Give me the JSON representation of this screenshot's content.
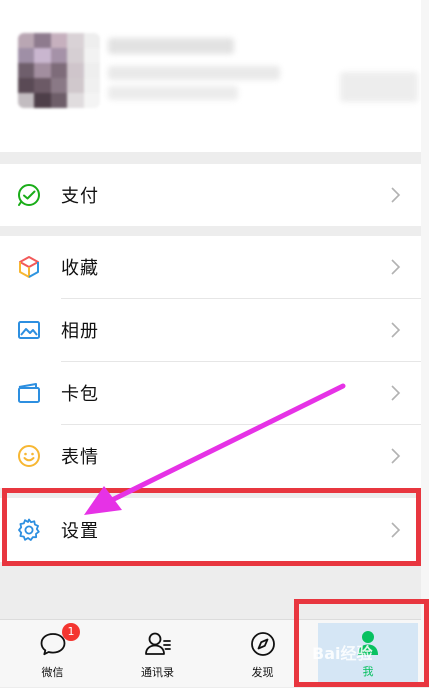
{
  "colors": {
    "accent_green": "#07c160",
    "annotation_red": "#e8363f",
    "arrow_magenta": "#e632e6",
    "badge_red": "#f43530"
  },
  "menu": {
    "pay": {
      "label": "支付",
      "icon": "wechat-pay-icon"
    },
    "favorites": {
      "label": "收藏",
      "icon": "cube-icon"
    },
    "album": {
      "label": "相册",
      "icon": "image-icon"
    },
    "cards": {
      "label": "卡包",
      "icon": "wallet-icon"
    },
    "stickers": {
      "label": "表情",
      "icon": "smiley-icon"
    },
    "settings": {
      "label": "设置",
      "icon": "gear-icon"
    }
  },
  "tabbar": {
    "chats": {
      "label": "微信",
      "badge": "1",
      "icon": "chat-bubble-icon"
    },
    "contacts": {
      "label": "通讯录",
      "icon": "contacts-icon"
    },
    "discover": {
      "label": "发现",
      "icon": "compass-icon"
    },
    "me": {
      "label": "我",
      "icon": "person-icon"
    }
  },
  "watermark": "Bai经验"
}
